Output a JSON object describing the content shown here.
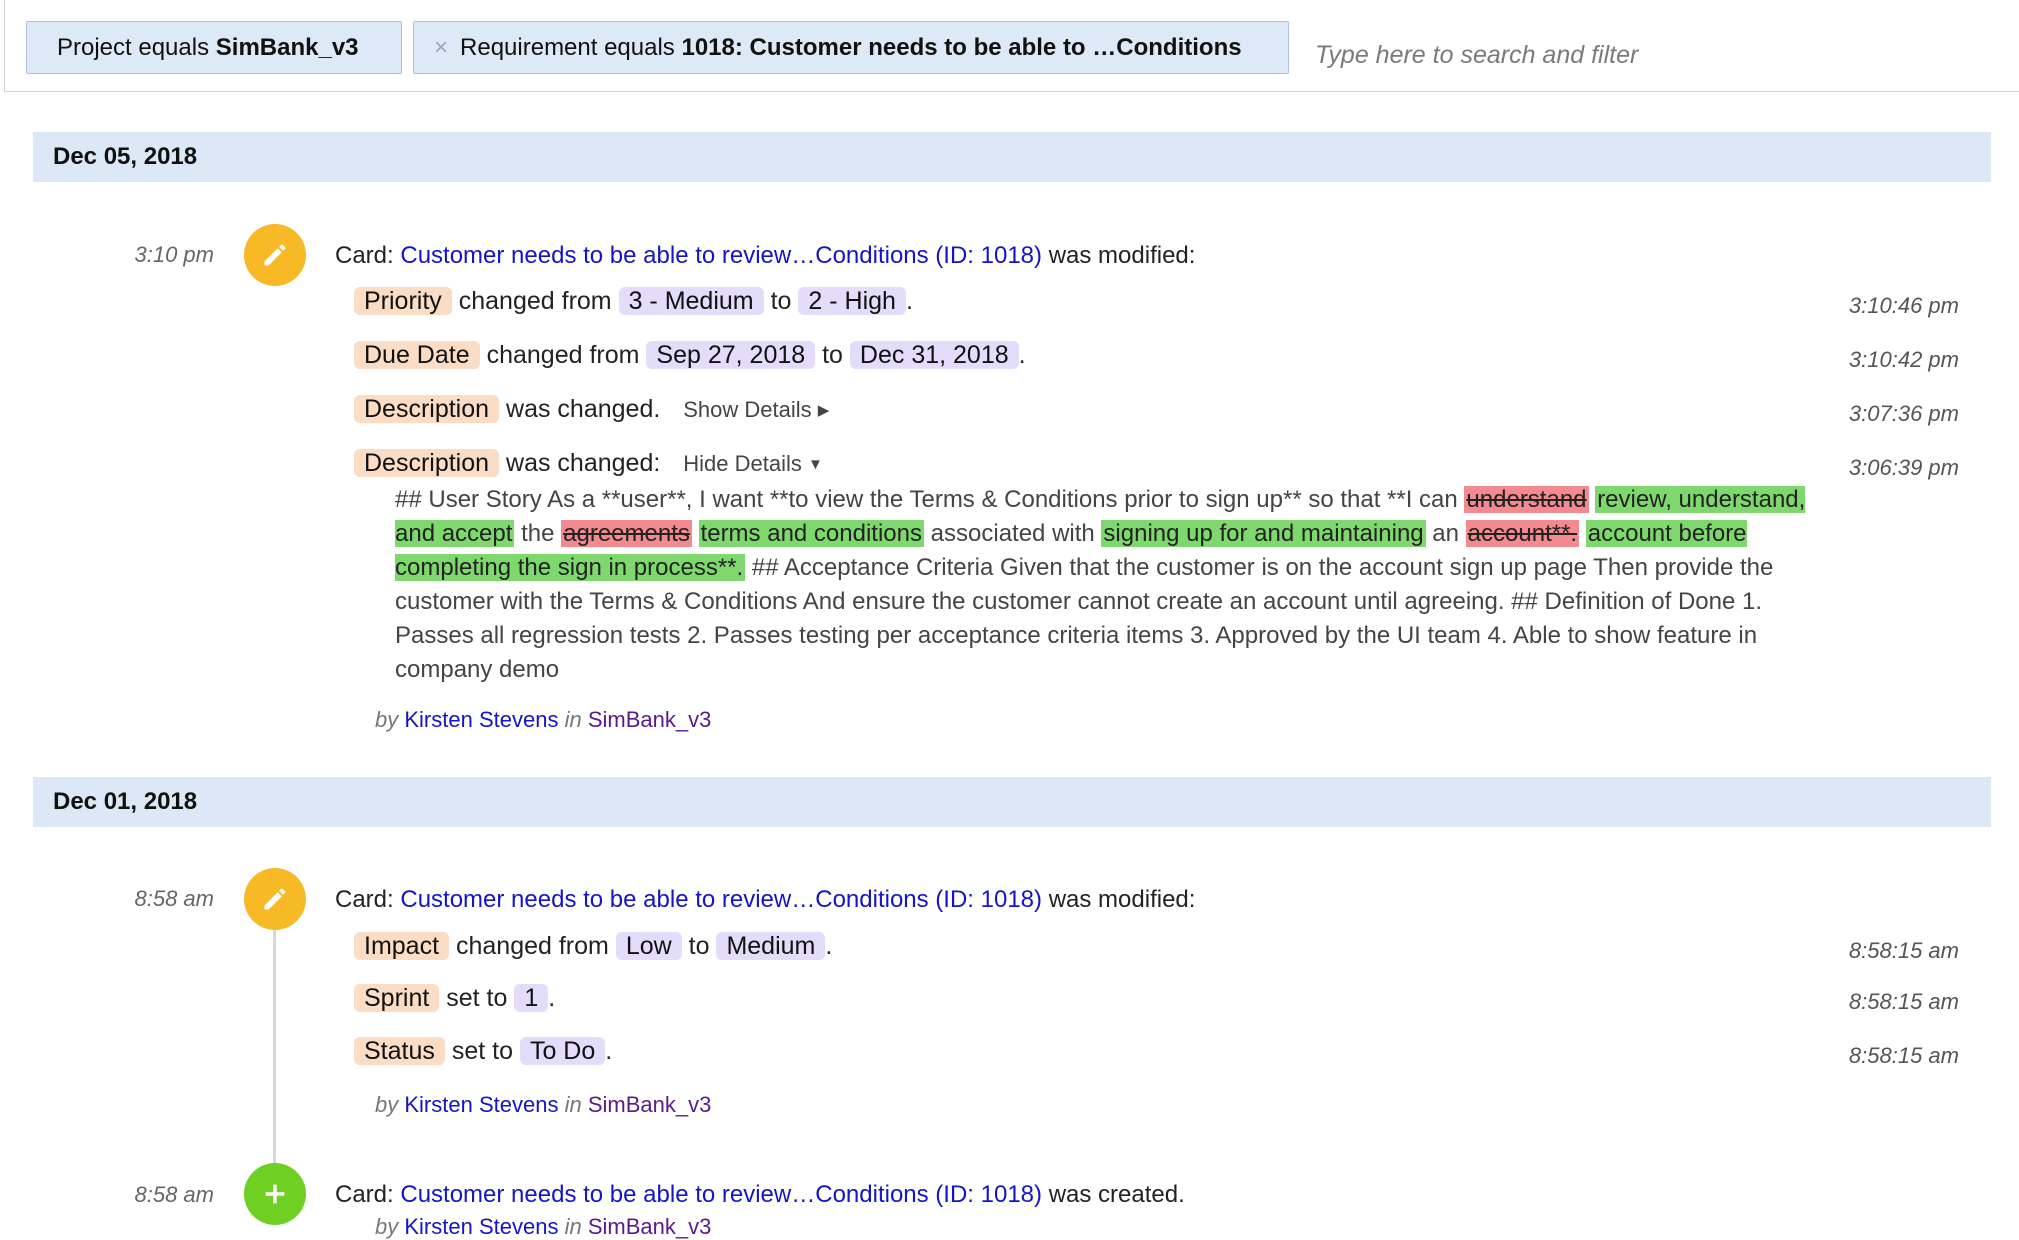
{
  "filters": {
    "chip1": {
      "prefix": "Project equals ",
      "value": "SimBank_v3"
    },
    "chip2": {
      "remove_icon": "×",
      "prefix": "Requirement equals ",
      "value": "1018: Customer needs to be able to …Conditions"
    },
    "search_placeholder": "Type here to search and filter"
  },
  "groups": [
    {
      "date": "Dec 05, 2018",
      "entries": [
        {
          "time": "3:10 pm",
          "icon": "pencil-icon",
          "card_prefix": "Card:",
          "card_link": "Customer needs to be able to review…Conditions (ID: 1018)",
          "card_suffix": "was modified:",
          "changes": [
            {
              "field": "Priority",
              "text1": "changed from",
              "from": "3 - Medium",
              "text2": "to",
              "to": "2 - High",
              "end": ".",
              "time": "3:10:46 pm"
            },
            {
              "field": "Due Date",
              "text1": "changed from",
              "from": "Sep 27, 2018",
              "text2": "to",
              "to": "Dec 31, 2018",
              "end": ".",
              "time": "3:10:42 pm"
            },
            {
              "field": "Description",
              "text1": "was changed.",
              "toggle": "Show Details",
              "time": "3:07:36 pm"
            },
            {
              "field": "Description",
              "text1": "was changed:",
              "toggle": "Hide Details",
              "time": "3:06:39 pm"
            }
          ],
          "diff": [
            {
              "t": "## User Story As a **user**, I want **to view the Terms & Conditions prior to sign up** so that **I can "
            },
            {
              "del": "understand"
            },
            {
              "t": " "
            },
            {
              "ins": "review, understand, and accept"
            },
            {
              "t": " the "
            },
            {
              "del": "agreements"
            },
            {
              "t": " "
            },
            {
              "ins": "terms and conditions"
            },
            {
              "t": " associated with "
            },
            {
              "ins": "signing up for and maintaining"
            },
            {
              "t": " an "
            },
            {
              "del": "account**."
            },
            {
              "t": " "
            },
            {
              "ins": "account before completing the sign in process**."
            },
            {
              "t": " ## Acceptance Criteria Given that the customer is on the account sign up page Then provide the customer with the Terms & Conditions And ensure the customer cannot create an account until agreeing. ## Definition of Done 1. Passes all regression tests 2. Passes testing per acceptance criteria items 3. Approved by the UI team 4. Able to show feature in company demo"
            }
          ],
          "by_label": "by",
          "author": "Kirsten Stevens",
          "in_label": "in",
          "project": "SimBank_v3"
        }
      ]
    },
    {
      "date": "Dec 01, 2018",
      "entries": [
        {
          "time": "8:58 am",
          "icon": "pencil-icon",
          "card_prefix": "Card:",
          "card_link": "Customer needs to be able to review…Conditions (ID: 1018)",
          "card_suffix": "was modified:",
          "changes": [
            {
              "field": "Impact",
              "text1": "changed from",
              "from": "Low",
              "text2": "to",
              "to": "Medium",
              "end": ".",
              "time": "8:58:15 am"
            },
            {
              "field": "Sprint",
              "text1": "set to",
              "to": "1",
              "end": ".",
              "time": "8:58:15 am"
            },
            {
              "field": "Status",
              "text1": "set to",
              "to": "To Do",
              "end": ".",
              "time": "8:58:15 am"
            }
          ],
          "by_label": "by",
          "author": "Kirsten Stevens",
          "in_label": "in",
          "project": "SimBank_v3"
        },
        {
          "time": "8:58 am",
          "icon": "plus-icon",
          "card_prefix": "Card:",
          "card_link": "Customer needs to be able to review…Conditions (ID: 1018)",
          "card_suffix": "was created.",
          "by_label": "by",
          "author": "Kirsten Stevens",
          "in_label": "in",
          "project": "SimBank_v3"
        }
      ]
    }
  ],
  "colors": {
    "date_bar": "#dce8f5",
    "chip": "#dde9f6",
    "field_tag": "#fbdcc4",
    "value_tag": "#e3dcfa",
    "deleted": "#f28a8f",
    "inserted": "#7ed86e",
    "modified_icon": "#f7b926",
    "created_icon": "#6fcf23",
    "link": "#1515c8"
  }
}
